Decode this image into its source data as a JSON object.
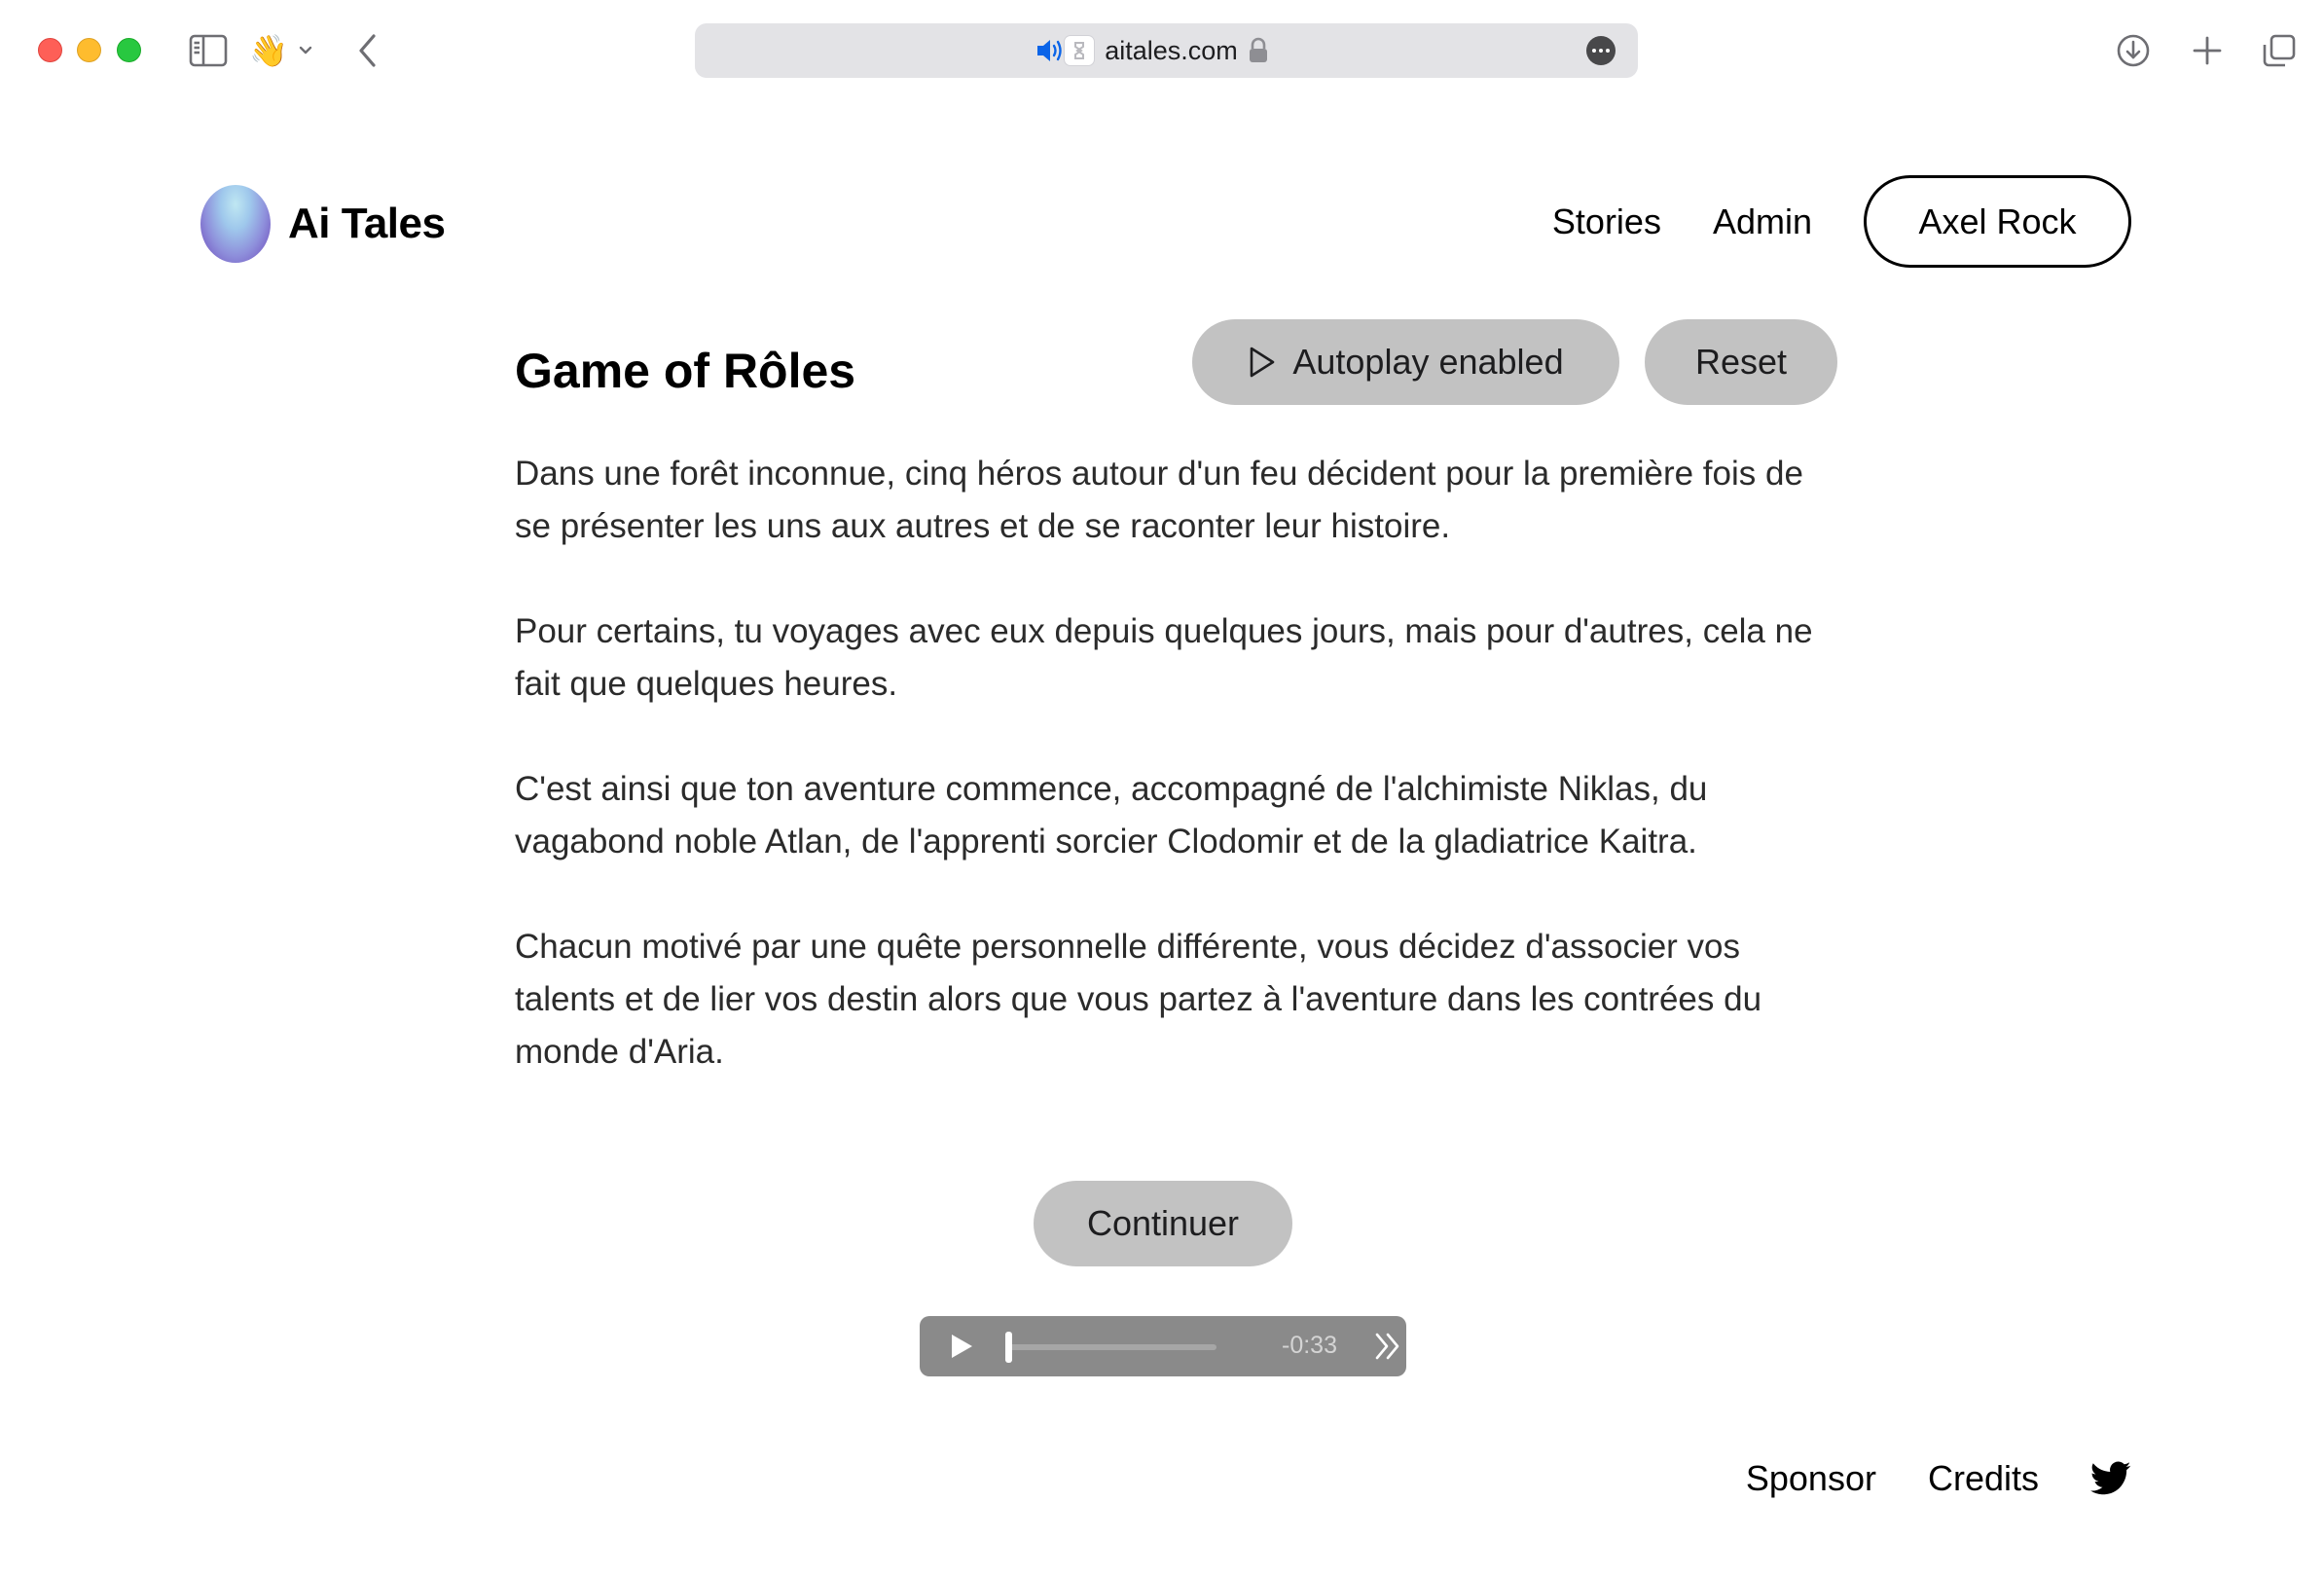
{
  "browser": {
    "address": "aitales.com",
    "icons": {
      "sidebar": "sidebar-toggle-icon",
      "profile_emoji": "👋",
      "back": "chevron-left-icon",
      "favicon": "site-favicon-icon",
      "lock": "lock-icon",
      "audio": "speaker-playing-icon",
      "more": "ellipsis-circle-icon",
      "download": "download-icon",
      "new_tab": "plus-icon",
      "tabs": "tab-overview-icon"
    }
  },
  "header": {
    "logo_text": "Ai Tales",
    "nav": {
      "stories": "Stories",
      "admin": "Admin"
    },
    "user_name": "Axel Rock"
  },
  "story": {
    "title": "Game of Rôles",
    "autoplay_label": "Autoplay enabled",
    "reset_label": "Reset",
    "paragraphs": [
      "Dans une forêt inconnue, cinq héros autour d'un feu décident pour la première fois de se présenter les uns aux autres et de se raconter leur histoire.",
      "Pour certains, tu voyages avec eux depuis quelques jours, mais pour d'autres, cela ne fait que quelques heures.",
      "C'est ainsi que ton aventure commence, accompagné de l'alchimiste Niklas, du vagabond noble Atlan, de l'apprenti sorcier Clodomir et de la gladiatrice Kaitra.",
      "Chacun motivé par une quête personnelle différente, vous décidez d'associer vos talents et de lier vos destin alors que vous partez à l'aventure dans les contrées du monde d'Aria."
    ],
    "continue_label": "Continuer"
  },
  "audio": {
    "remaining": "-0:33",
    "progress": 0.0
  },
  "footer": {
    "sponsor": "Sponsor",
    "credits": "Credits",
    "social_icon": "twitter-bird-icon"
  },
  "colors": {
    "button_gray": "#c2c2c2",
    "audio_bg": "#8a8a8a",
    "address_bar": "#e3e3e6",
    "speaker_blue": "#0a64e8"
  }
}
